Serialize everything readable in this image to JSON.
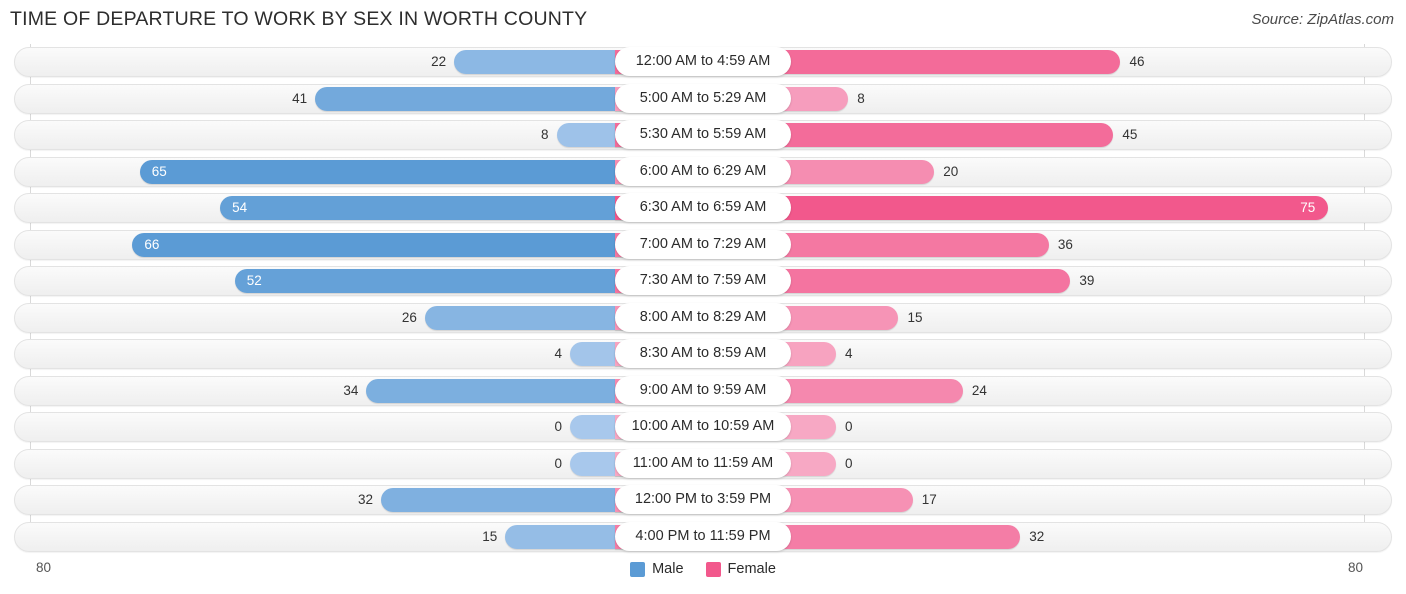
{
  "header": {
    "title": "TIME OF DEPARTURE TO WORK BY SEX IN WORTH COUNTY",
    "source": "Source: ZipAtlas.com"
  },
  "axis": {
    "left_end": "80",
    "right_end": "80",
    "max": 80
  },
  "legend": {
    "items": [
      {
        "label": "Male",
        "color": "#5b9bd5"
      },
      {
        "label": "Female",
        "color": "#f2588c"
      }
    ]
  },
  "colors": {
    "male_strong": "#5b9bd5",
    "male_light": "#a8c8ec",
    "female_strong": "#f2588c",
    "female_light": "#f7a8c4",
    "track_bg": "#f4f4f4",
    "track_border": "#e3e3e3",
    "gridline": "#d9d9d9",
    "title": "#2d2d2d"
  },
  "chart_data": {
    "type": "bar",
    "orientation": "horizontal-diverging",
    "title": "TIME OF DEPARTURE TO WORK BY SEX IN WORTH COUNTY",
    "xlabel": "",
    "ylabel": "",
    "xlim": [
      80,
      80
    ],
    "grid": true,
    "legend_position": "bottom-center",
    "categories": [
      "12:00 AM to 4:59 AM",
      "5:00 AM to 5:29 AM",
      "5:30 AM to 5:59 AM",
      "6:00 AM to 6:29 AM",
      "6:30 AM to 6:59 AM",
      "7:00 AM to 7:29 AM",
      "7:30 AM to 7:59 AM",
      "8:00 AM to 8:29 AM",
      "8:30 AM to 8:59 AM",
      "9:00 AM to 9:59 AM",
      "10:00 AM to 10:59 AM",
      "11:00 AM to 11:59 AM",
      "12:00 PM to 3:59 PM",
      "4:00 PM to 11:59 PM"
    ],
    "series": [
      {
        "name": "Male",
        "values": [
          22,
          41,
          8,
          65,
          54,
          66,
          52,
          26,
          4,
          34,
          0,
          0,
          32,
          15
        ]
      },
      {
        "name": "Female",
        "values": [
          46,
          8,
          45,
          20,
          75,
          36,
          39,
          15,
          4,
          24,
          0,
          0,
          17,
          32
        ]
      }
    ]
  }
}
